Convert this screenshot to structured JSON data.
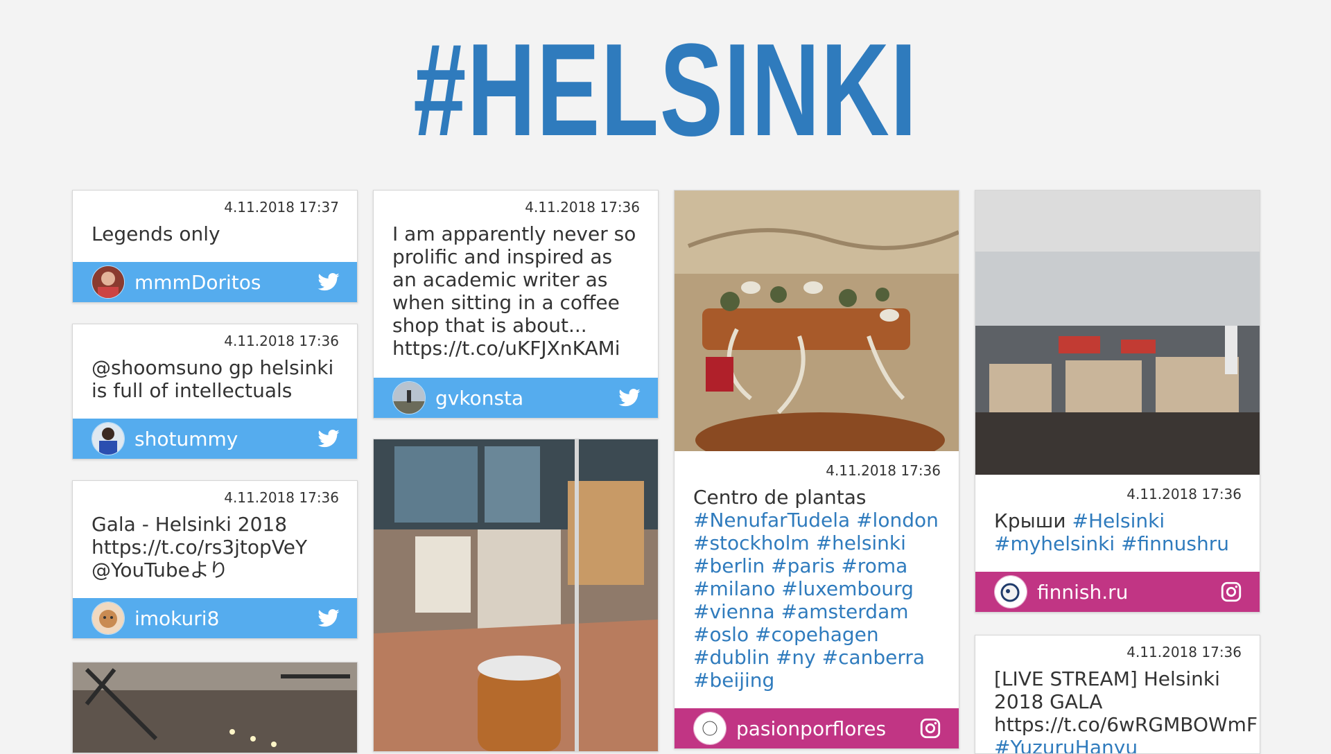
{
  "page": {
    "title": "#HELSINKI"
  },
  "colors": {
    "title": "#2f7bbd",
    "twitter": "#55acee",
    "instagram": "#c13584",
    "hashtag": "#2f7bbd"
  },
  "posts": [
    {
      "date": "4.11.2018 17:37",
      "text": "Legends only",
      "user": "mmmDoritos",
      "network": "twitter-icon"
    },
    {
      "date": "4.11.2018 17:36",
      "text": "@shoomsuno gp helsinki is full of intellectuals",
      "user": "shotummy",
      "network": "twitter-icon"
    },
    {
      "date": "4.11.2018 17:36",
      "text_lines": [
        "Gala - Helsinki 2018",
        "https://t.co/rs3jtopVeY",
        "@YouTubeより"
      ],
      "user": "imokuri8",
      "network": "twitter-icon"
    },
    {
      "date": "4.11.2018 17:36",
      "text": "I am apparently never so prolific and inspired as an academic writer as when sitting in a coffee shop that is about... https://t.co/uKFJXnKAMi",
      "user": "gvkonsta",
      "network": "twitter-icon"
    },
    {
      "date": "4.11.2018 17:36",
      "text": "Centro de plantas",
      "hashtags": "#NenufarTudela #london #stockholm #helsinki #berlin #paris #roma #milano #luxembourg #vienna #amsterdam #oslo #copehagen #dublin #ny #canberra #beijing",
      "user": "pasionporflores",
      "network": "instagram-icon"
    },
    {
      "date": "4.11.2018 17:36",
      "text": "Крыши",
      "hashtags": "#Helsinki #myhelsinki #finnushru",
      "user": "finnish.ru",
      "network": "instagram-icon"
    },
    {
      "date": "4.11.2018 17:36",
      "text_lines": [
        "[LIVE STREAM] Helsinki",
        "2018 GALA",
        "https://t.co/6wRGMBOWmF"
      ],
      "hashtags": "#YuzuruHanyu",
      "network": "twitter-icon"
    }
  ]
}
